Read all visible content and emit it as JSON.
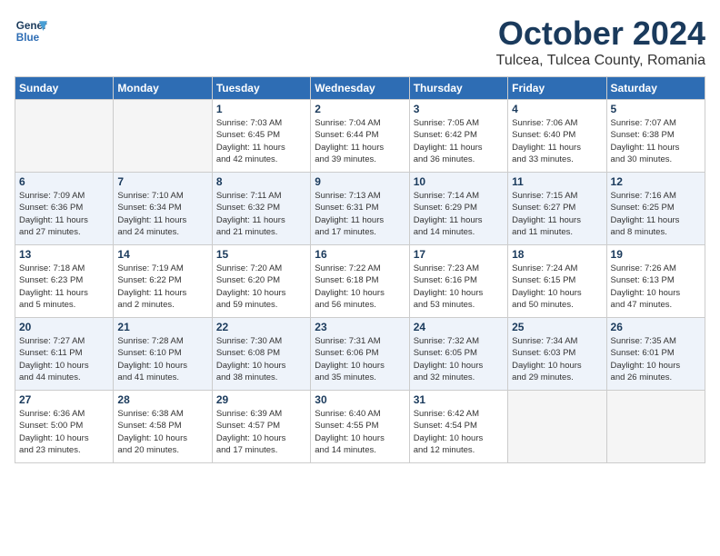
{
  "header": {
    "logo_line1": "General",
    "logo_line2": "Blue",
    "month": "October 2024",
    "location": "Tulcea, Tulcea County, Romania"
  },
  "days_of_week": [
    "Sunday",
    "Monday",
    "Tuesday",
    "Wednesday",
    "Thursday",
    "Friday",
    "Saturday"
  ],
  "weeks": [
    [
      {
        "day": "",
        "empty": true
      },
      {
        "day": "",
        "empty": true
      },
      {
        "day": "1",
        "line1": "Sunrise: 7:03 AM",
        "line2": "Sunset: 6:45 PM",
        "line3": "Daylight: 11 hours",
        "line4": "and 42 minutes."
      },
      {
        "day": "2",
        "line1": "Sunrise: 7:04 AM",
        "line2": "Sunset: 6:44 PM",
        "line3": "Daylight: 11 hours",
        "line4": "and 39 minutes."
      },
      {
        "day": "3",
        "line1": "Sunrise: 7:05 AM",
        "line2": "Sunset: 6:42 PM",
        "line3": "Daylight: 11 hours",
        "line4": "and 36 minutes."
      },
      {
        "day": "4",
        "line1": "Sunrise: 7:06 AM",
        "line2": "Sunset: 6:40 PM",
        "line3": "Daylight: 11 hours",
        "line4": "and 33 minutes."
      },
      {
        "day": "5",
        "line1": "Sunrise: 7:07 AM",
        "line2": "Sunset: 6:38 PM",
        "line3": "Daylight: 11 hours",
        "line4": "and 30 minutes."
      }
    ],
    [
      {
        "day": "6",
        "line1": "Sunrise: 7:09 AM",
        "line2": "Sunset: 6:36 PM",
        "line3": "Daylight: 11 hours",
        "line4": "and 27 minutes."
      },
      {
        "day": "7",
        "line1": "Sunrise: 7:10 AM",
        "line2": "Sunset: 6:34 PM",
        "line3": "Daylight: 11 hours",
        "line4": "and 24 minutes."
      },
      {
        "day": "8",
        "line1": "Sunrise: 7:11 AM",
        "line2": "Sunset: 6:32 PM",
        "line3": "Daylight: 11 hours",
        "line4": "and 21 minutes."
      },
      {
        "day": "9",
        "line1": "Sunrise: 7:13 AM",
        "line2": "Sunset: 6:31 PM",
        "line3": "Daylight: 11 hours",
        "line4": "and 17 minutes."
      },
      {
        "day": "10",
        "line1": "Sunrise: 7:14 AM",
        "line2": "Sunset: 6:29 PM",
        "line3": "Daylight: 11 hours",
        "line4": "and 14 minutes."
      },
      {
        "day": "11",
        "line1": "Sunrise: 7:15 AM",
        "line2": "Sunset: 6:27 PM",
        "line3": "Daylight: 11 hours",
        "line4": "and 11 minutes."
      },
      {
        "day": "12",
        "line1": "Sunrise: 7:16 AM",
        "line2": "Sunset: 6:25 PM",
        "line3": "Daylight: 11 hours",
        "line4": "and 8 minutes."
      }
    ],
    [
      {
        "day": "13",
        "line1": "Sunrise: 7:18 AM",
        "line2": "Sunset: 6:23 PM",
        "line3": "Daylight: 11 hours",
        "line4": "and 5 minutes."
      },
      {
        "day": "14",
        "line1": "Sunrise: 7:19 AM",
        "line2": "Sunset: 6:22 PM",
        "line3": "Daylight: 11 hours",
        "line4": "and 2 minutes."
      },
      {
        "day": "15",
        "line1": "Sunrise: 7:20 AM",
        "line2": "Sunset: 6:20 PM",
        "line3": "Daylight: 10 hours",
        "line4": "and 59 minutes."
      },
      {
        "day": "16",
        "line1": "Sunrise: 7:22 AM",
        "line2": "Sunset: 6:18 PM",
        "line3": "Daylight: 10 hours",
        "line4": "and 56 minutes."
      },
      {
        "day": "17",
        "line1": "Sunrise: 7:23 AM",
        "line2": "Sunset: 6:16 PM",
        "line3": "Daylight: 10 hours",
        "line4": "and 53 minutes."
      },
      {
        "day": "18",
        "line1": "Sunrise: 7:24 AM",
        "line2": "Sunset: 6:15 PM",
        "line3": "Daylight: 10 hours",
        "line4": "and 50 minutes."
      },
      {
        "day": "19",
        "line1": "Sunrise: 7:26 AM",
        "line2": "Sunset: 6:13 PM",
        "line3": "Daylight: 10 hours",
        "line4": "and 47 minutes."
      }
    ],
    [
      {
        "day": "20",
        "line1": "Sunrise: 7:27 AM",
        "line2": "Sunset: 6:11 PM",
        "line3": "Daylight: 10 hours",
        "line4": "and 44 minutes."
      },
      {
        "day": "21",
        "line1": "Sunrise: 7:28 AM",
        "line2": "Sunset: 6:10 PM",
        "line3": "Daylight: 10 hours",
        "line4": "and 41 minutes."
      },
      {
        "day": "22",
        "line1": "Sunrise: 7:30 AM",
        "line2": "Sunset: 6:08 PM",
        "line3": "Daylight: 10 hours",
        "line4": "and 38 minutes."
      },
      {
        "day": "23",
        "line1": "Sunrise: 7:31 AM",
        "line2": "Sunset: 6:06 PM",
        "line3": "Daylight: 10 hours",
        "line4": "and 35 minutes."
      },
      {
        "day": "24",
        "line1": "Sunrise: 7:32 AM",
        "line2": "Sunset: 6:05 PM",
        "line3": "Daylight: 10 hours",
        "line4": "and 32 minutes."
      },
      {
        "day": "25",
        "line1": "Sunrise: 7:34 AM",
        "line2": "Sunset: 6:03 PM",
        "line3": "Daylight: 10 hours",
        "line4": "and 29 minutes."
      },
      {
        "day": "26",
        "line1": "Sunrise: 7:35 AM",
        "line2": "Sunset: 6:01 PM",
        "line3": "Daylight: 10 hours",
        "line4": "and 26 minutes."
      }
    ],
    [
      {
        "day": "27",
        "line1": "Sunrise: 6:36 AM",
        "line2": "Sunset: 5:00 PM",
        "line3": "Daylight: 10 hours",
        "line4": "and 23 minutes."
      },
      {
        "day": "28",
        "line1": "Sunrise: 6:38 AM",
        "line2": "Sunset: 4:58 PM",
        "line3": "Daylight: 10 hours",
        "line4": "and 20 minutes."
      },
      {
        "day": "29",
        "line1": "Sunrise: 6:39 AM",
        "line2": "Sunset: 4:57 PM",
        "line3": "Daylight: 10 hours",
        "line4": "and 17 minutes."
      },
      {
        "day": "30",
        "line1": "Sunrise: 6:40 AM",
        "line2": "Sunset: 4:55 PM",
        "line3": "Daylight: 10 hours",
        "line4": "and 14 minutes."
      },
      {
        "day": "31",
        "line1": "Sunrise: 6:42 AM",
        "line2": "Sunset: 4:54 PM",
        "line3": "Daylight: 10 hours",
        "line4": "and 12 minutes."
      },
      {
        "day": "",
        "empty": true
      },
      {
        "day": "",
        "empty": true
      }
    ]
  ]
}
